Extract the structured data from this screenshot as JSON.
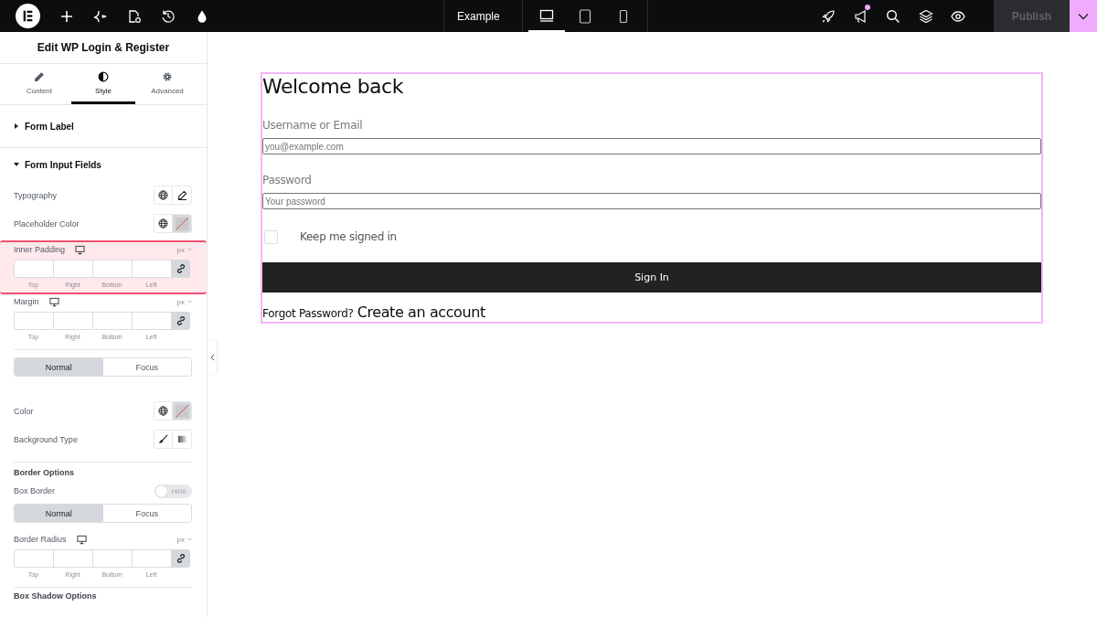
{
  "topbar": {
    "tools": [
      {
        "kind": "plus"
      },
      {
        "kind": "sparkle"
      },
      {
        "kind": "page"
      },
      {
        "kind": "history"
      },
      {
        "kind": "drop"
      }
    ],
    "site": "Example",
    "devices": [
      {
        "kind": "desktop",
        "selected": true
      },
      {
        "kind": "tablet",
        "selected": false
      },
      {
        "kind": "mobile",
        "selected": false
      }
    ],
    "actions": [
      {
        "kind": "rocket",
        "notify": false
      },
      {
        "kind": "megaphone",
        "notify": true
      },
      {
        "kind": "search",
        "notify": false
      },
      {
        "kind": "layers",
        "notify": false
      },
      {
        "kind": "eye",
        "notify": false
      }
    ],
    "publish": {
      "label": "Publish",
      "disabled": true
    }
  },
  "panel": {
    "title": "Edit WP Login & Register",
    "tabs": [
      {
        "label": "Content",
        "kind": "pencil",
        "selected": false
      },
      {
        "label": "Style",
        "kind": "contrast",
        "selected": true
      },
      {
        "label": "Advanced",
        "kind": "gear",
        "selected": false
      }
    ],
    "sections": [
      {
        "title": "Form Label",
        "expanded": false
      },
      {
        "title": "Form Input Fields",
        "expanded": true,
        "controls": [
          {
            "kind": "picker",
            "label": "Typography",
            "buttons": [
              {
                "kind": "globe"
              },
              {
                "kind": "pencil"
              }
            ]
          },
          {
            "kind": "picker",
            "label": "Placeholder Color",
            "buttons": [
              {
                "kind": "globe"
              },
              {
                "kind": "swatch"
              }
            ]
          },
          {
            "kind": "dimensions",
            "label": "Inner Padding",
            "unit": "px",
            "highlighted": true,
            "sides": [
              "Top",
              "Right",
              "Bottom",
              "Left"
            ]
          },
          {
            "kind": "dimensions",
            "label": "Margin",
            "unit": "px",
            "highlighted": false,
            "sides": [
              "Top",
              "Right",
              "Bottom",
              "Left"
            ]
          },
          {
            "kind": "divider"
          },
          {
            "kind": "states",
            "options": [
              {
                "label": "Normal",
                "selected": true
              },
              {
                "label": "Focus",
                "selected": false
              }
            ]
          },
          {
            "kind": "picker",
            "label": "Color",
            "buttons": [
              {
                "kind": "globe"
              },
              {
                "kind": "swatch"
              }
            ]
          },
          {
            "kind": "picker",
            "label": "Background Type",
            "buttons": [
              {
                "kind": "brush"
              },
              {
                "kind": "gradient"
              }
            ]
          },
          {
            "kind": "divider"
          },
          {
            "kind": "heading",
            "label": "Border Options"
          },
          {
            "kind": "toggle",
            "label": "Box Border",
            "on": false,
            "text": "Hide"
          },
          {
            "kind": "states",
            "options": [
              {
                "label": "Normal",
                "selected": true
              },
              {
                "label": "Focus",
                "selected": false
              }
            ]
          },
          {
            "kind": "dimensions",
            "label": "Border Radius",
            "unit": "px",
            "highlighted": false,
            "sides": [
              "Top",
              "Right",
              "Bottom",
              "Left"
            ]
          },
          {
            "kind": "divider"
          },
          {
            "kind": "heading",
            "label": "Box Shadow Options"
          }
        ]
      }
    ]
  },
  "form": {
    "title": "Welcome back",
    "fields": [
      {
        "label": "Username or Email",
        "placeholder": "you@example.com"
      },
      {
        "label": "Password",
        "placeholder": "Your password"
      }
    ],
    "remember": {
      "label": "Keep me signed in",
      "checked": false
    },
    "submit": "Sign In",
    "forgot": "Forgot Password?",
    "register": "Create an account"
  }
}
